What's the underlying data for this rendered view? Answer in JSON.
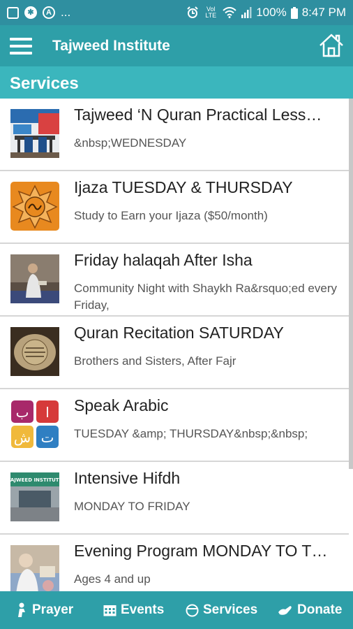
{
  "status_bar": {
    "ellipsis": "...",
    "network": "Vol LTE",
    "battery": "100%",
    "time": "8:47 PM"
  },
  "app_bar": {
    "title": "Tajweed Institute"
  },
  "section": {
    "title": "Services"
  },
  "items": [
    {
      "title": "Tajweed ‘N Quran Practical Less…",
      "subtitle": "&nbsp;WEDNESDAY"
    },
    {
      "title": "Ijaza TUESDAY & THURSDAY",
      "subtitle": "Study to Earn your Ijaza ($50/month)"
    },
    {
      "title": "Friday halaqah After Isha",
      "subtitle": "Community Night with Shaykh Ra&rsquo;ed every Friday,"
    },
    {
      "title": "Quran Recitation SATURDAY",
      "subtitle": "Brothers and Sisters, After Fajr"
    },
    {
      "title": "Speak Arabic",
      "subtitle": "TUESDAY &amp; THURSDAY&nbsp;&nbsp;",
      "letters": [
        "ب",
        "ا",
        "ش",
        "ت"
      ]
    },
    {
      "title": "Intensive Hifdh",
      "subtitle": "MONDAY TO FRIDAY",
      "sign": "TAJWEED INSTITUTE"
    },
    {
      "title": "Evening Program MONDAY TO T…",
      "subtitle": "Ages 4 and up"
    }
  ],
  "bottom_nav": [
    {
      "label": "Prayer",
      "icon": "prayer-icon"
    },
    {
      "label": "Events",
      "icon": "calendar-icon"
    },
    {
      "label": "Services",
      "icon": "services-icon"
    },
    {
      "label": "Donate",
      "icon": "donate-icon"
    }
  ],
  "colors": {
    "status_bar": "#2f8fa0",
    "app_bar": "#2e9fa8",
    "section_header": "#3bb6bd"
  }
}
